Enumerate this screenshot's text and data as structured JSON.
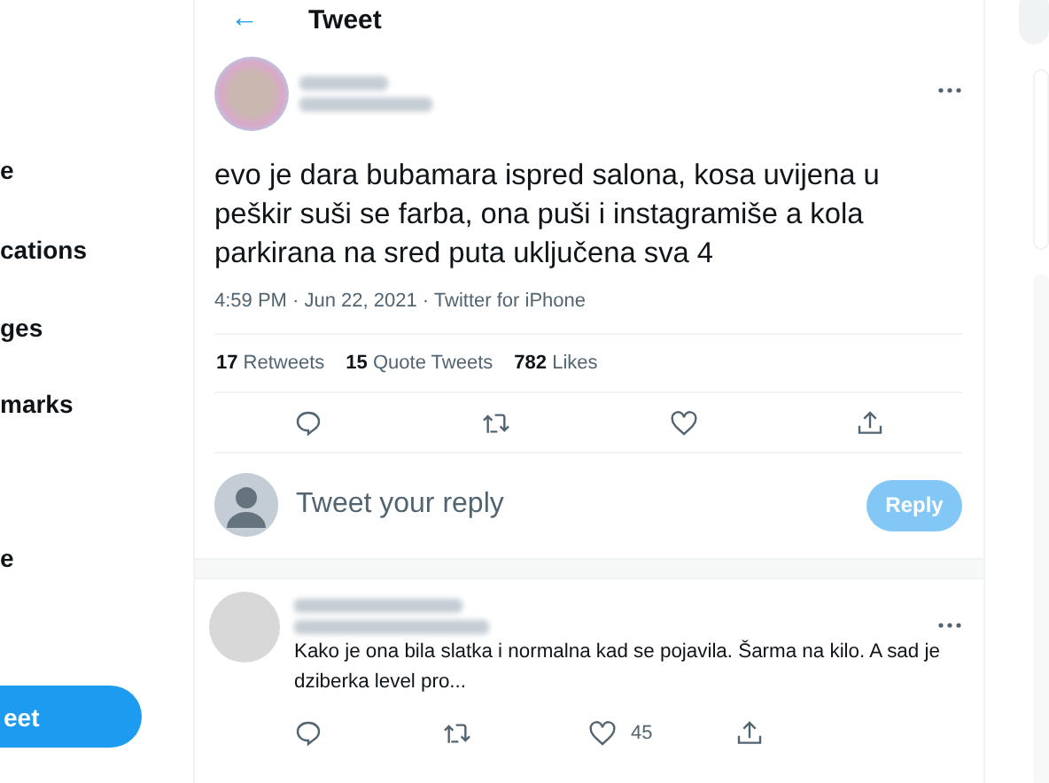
{
  "sidebar": {
    "items": [
      {
        "label": "e"
      },
      {
        "label": "cations"
      },
      {
        "label": "ges"
      },
      {
        "label": "marks"
      },
      {
        "label": "e"
      }
    ],
    "tweet_button": "eet"
  },
  "header": {
    "back": "←",
    "title": "Tweet"
  },
  "tweet": {
    "text": "evo je dara bubamara ispred salona, kosa uvijena u peškir suši se farba, ona puši i instagramiše a kola parkirana na sred puta uključena sva 4",
    "meta": "4:59 PM · Jun 22, 2021 · Twitter for iPhone",
    "stats": [
      {
        "count": "17",
        "label": "Retweets"
      },
      {
        "count": "15",
        "label": "Quote Tweets"
      },
      {
        "count": "782",
        "label": "Likes"
      }
    ]
  },
  "reply_box": {
    "placeholder": "Tweet your reply",
    "button": "Reply",
    "disabled": true
  },
  "replies": [
    {
      "text": "Kako je ona bila slatka i normalna kad se pojavila. Šarma na kilo. A sad je dziberka level pro...",
      "likes": "45"
    }
  ]
}
